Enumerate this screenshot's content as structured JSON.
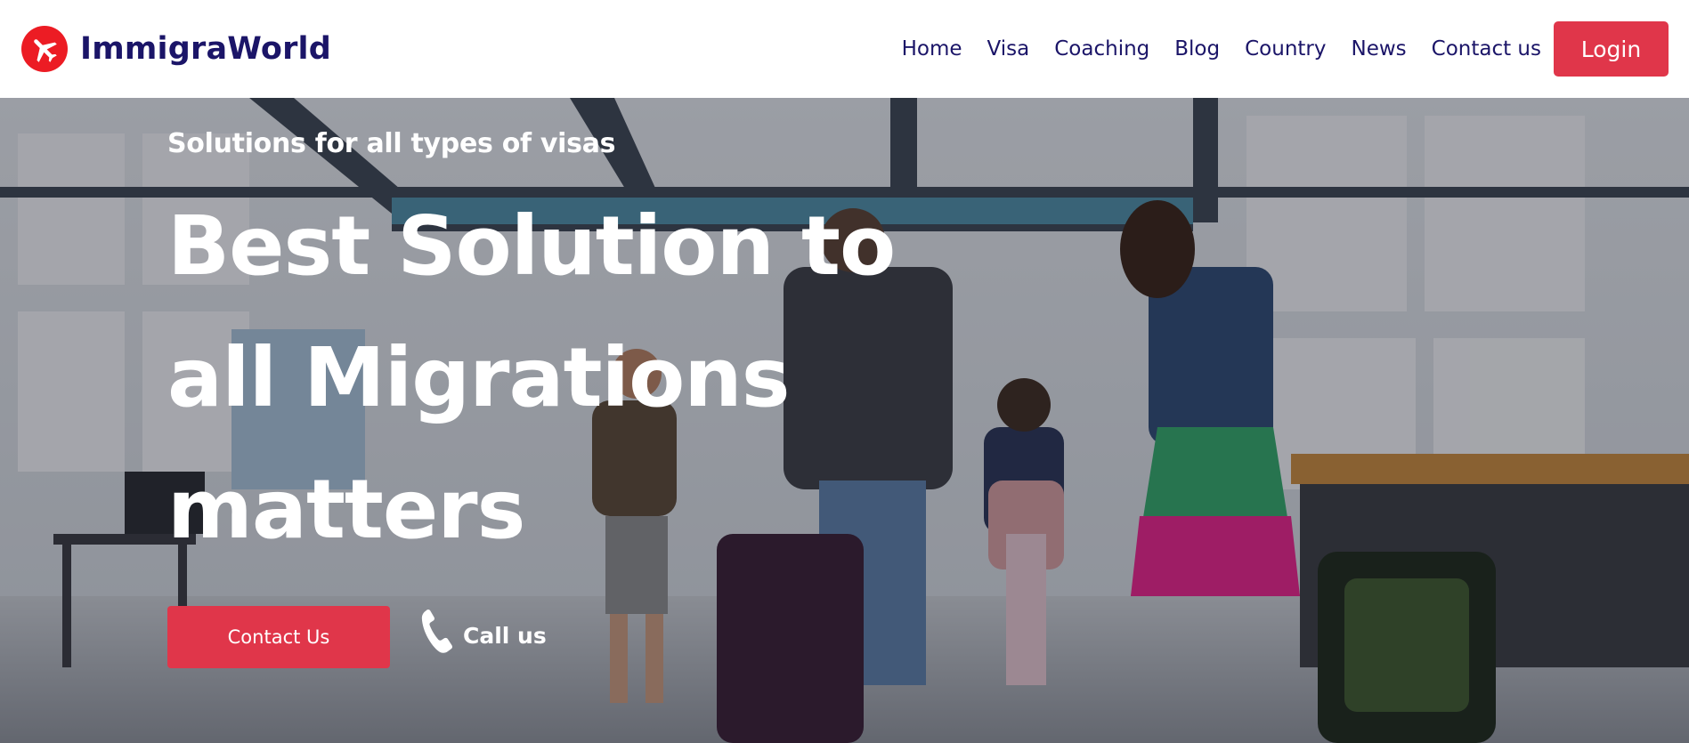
{
  "header": {
    "logo_icon": "airplane-icon",
    "brand": "ImmigraWorld",
    "nav": [
      "Home",
      "Visa",
      "Coaching",
      "Blog",
      "Country",
      "News",
      "Contact us"
    ],
    "login_label": "Login"
  },
  "hero": {
    "eyebrow": "Solutions for all types of visas",
    "headline_lines": [
      "Best Solution to",
      "all Migrations",
      "matters"
    ],
    "contact_label": "Contact Us",
    "call_icon": "phone-icon",
    "call_label": "Call us"
  },
  "colors": {
    "brand_navy": "#1b1568",
    "accent_red": "#e0364a",
    "logo_red": "#ec1c24",
    "hero_text": "#ffffff"
  }
}
